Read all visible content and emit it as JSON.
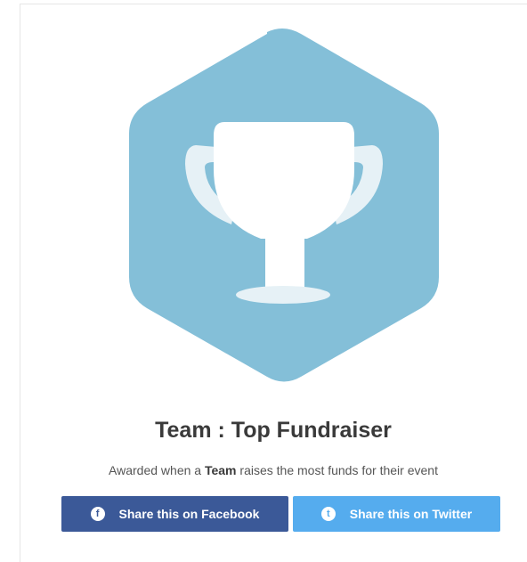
{
  "badge": {
    "icon": "trophy-icon",
    "hexagon_color": "#84bfd8",
    "trophy_color": "#ffffff",
    "trophy_handle_color": "#e6f1f6"
  },
  "title": "Team : Top Fundraiser",
  "description": {
    "prefix": "Awarded when a ",
    "emphasis": "Team",
    "suffix": " raises the most funds for their event"
  },
  "share": {
    "facebook": {
      "label": "Share this on Facebook",
      "icon": "facebook-icon",
      "glyph": "f",
      "color": "#3b5998"
    },
    "twitter": {
      "label": "Share this on Twitter",
      "icon": "twitter-icon",
      "glyph": "t",
      "color": "#55acee"
    }
  }
}
